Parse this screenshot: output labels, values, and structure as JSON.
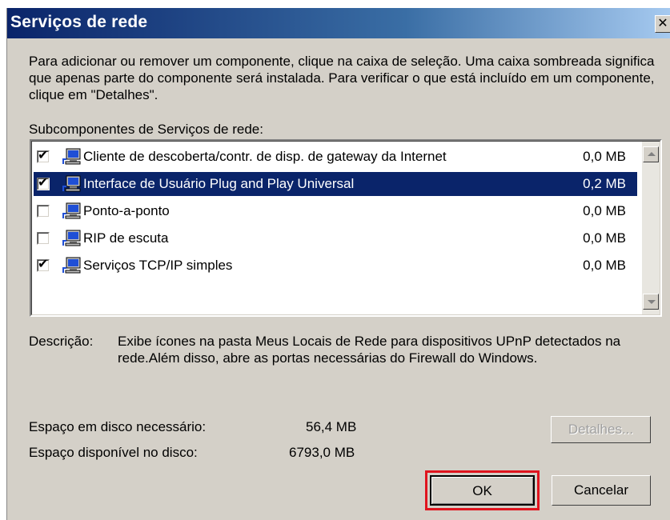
{
  "window": {
    "title": "Serviços de rede",
    "close_glyph": "✕"
  },
  "intro_text": "Para adicionar ou remover um componente, clique na caixa de seleção. Uma caixa sombreada significa que apenas parte do componente será instalada. Para verificar o que está incluído em um componente, clique em \"Detalhes\".",
  "list": {
    "label": "Subcomponentes de Serviços de rede:",
    "items": [
      {
        "label": "Cliente de descoberta/contr. de disp. de gateway da Internet",
        "size": "0,0 MB",
        "checked": true,
        "selected": false
      },
      {
        "label": "Interface de Usuário Plug and Play Universal",
        "size": "0,2 MB",
        "checked": true,
        "selected": true
      },
      {
        "label": "Ponto-a-ponto",
        "size": "0,0 MB",
        "checked": false,
        "selected": false
      },
      {
        "label": "RIP de escuta",
        "size": "0,0 MB",
        "checked": false,
        "selected": false
      },
      {
        "label": "Serviços TCP/IP simples",
        "size": "0,0 MB",
        "checked": true,
        "selected": false
      }
    ]
  },
  "description": {
    "label": "Descrição:",
    "text": "Exibe ícones na pasta Meus Locais de Rede para dispositivos UPnP detectados na rede.Além disso, abre as portas necessárias do Firewall do Windows."
  },
  "disk": {
    "required_label": "Espaço em disco necessário:",
    "required_value": "56,4 MB",
    "available_label": "Espaço disponível no disco:",
    "available_value": "6793,0 MB"
  },
  "buttons": {
    "details": "Detalhes...",
    "ok": "OK",
    "cancel": "Cancelar"
  },
  "icons": {
    "item_icon": "network-computer-icon",
    "checkmark": "✔"
  },
  "colors": {
    "selection": "#0a246a",
    "highlight_outline": "#e0141e",
    "dialog_bg": "#d4d0c8"
  }
}
